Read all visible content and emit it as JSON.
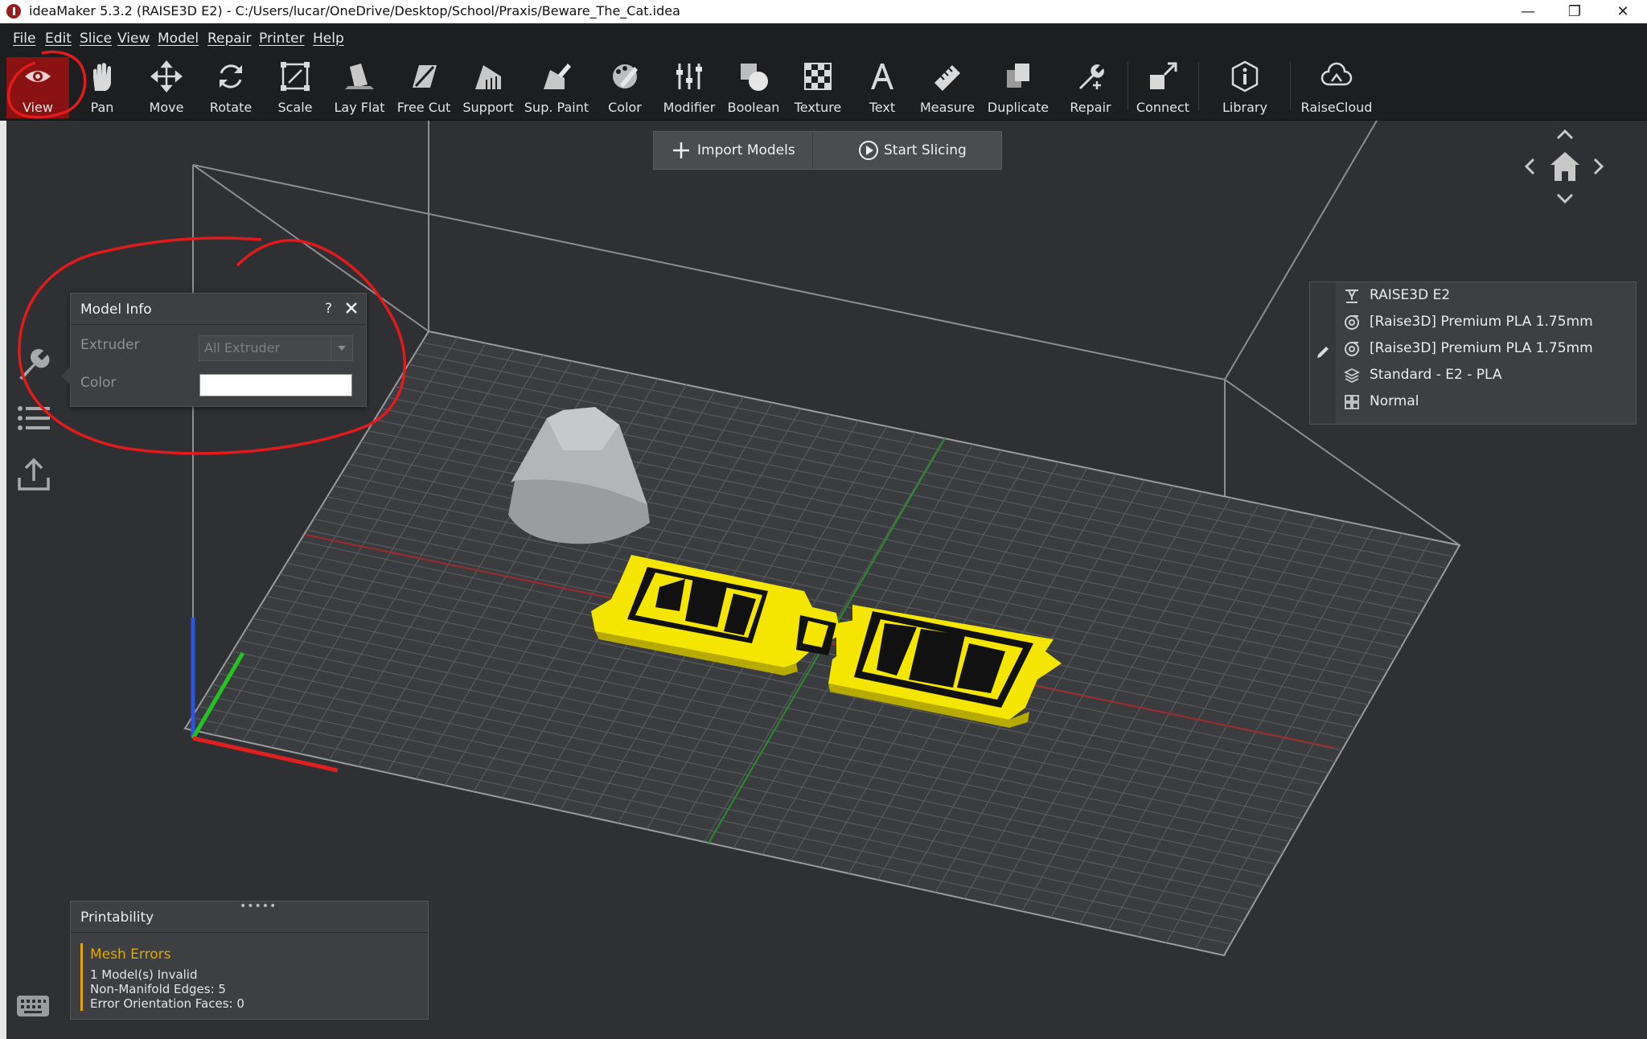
{
  "window": {
    "title": "ideaMaker 5.3.2 (RAISE3D E2) - C:/Users/lucar/OneDrive/Desktop/School/Praxis/Beware_The_Cat.idea",
    "controls": {
      "minimize": "—",
      "restore": "❐",
      "close": "✕"
    }
  },
  "menu": [
    "File",
    "Edit",
    "Slice",
    "View",
    "Model",
    "Repair",
    "Printer",
    "Help"
  ],
  "toolbar": {
    "tools": [
      {
        "label": "View",
        "icon": "eye-icon",
        "active": true
      },
      {
        "label": "Pan",
        "icon": "hand-icon"
      },
      {
        "label": "Move",
        "icon": "move-icon"
      },
      {
        "label": "Rotate",
        "icon": "rotate-icon"
      },
      {
        "label": "Scale",
        "icon": "scale-icon"
      },
      {
        "label": "Lay Flat",
        "icon": "lay-flat-icon"
      },
      {
        "label": "Free Cut",
        "icon": "free-cut-icon"
      },
      {
        "label": "Support",
        "icon": "support-icon"
      },
      {
        "label": "Sup. Paint",
        "icon": "support-paint-icon"
      },
      {
        "label": "Color",
        "icon": "color-icon"
      },
      {
        "label": "Modifier",
        "icon": "modifier-icon"
      },
      {
        "label": "Boolean",
        "icon": "boolean-icon"
      },
      {
        "label": "Texture",
        "icon": "texture-icon"
      },
      {
        "label": "Text",
        "icon": "text-icon"
      },
      {
        "label": "Measure",
        "icon": "measure-icon"
      },
      {
        "label": "Duplicate",
        "icon": "duplicate-icon"
      },
      {
        "label": "Repair",
        "icon": "repair-icon"
      },
      {
        "label": "Connect",
        "icon": "connect-icon"
      },
      {
        "label": "Library",
        "icon": "library-icon"
      },
      {
        "label": "RaiseCloud",
        "icon": "cloud-icon"
      }
    ],
    "accent": "#8a1212"
  },
  "actions": {
    "import_label": "Import Models",
    "slice_label": "Start Slicing"
  },
  "model_info": {
    "title": "Model Info",
    "help": "?",
    "extruder_label": "Extruder",
    "extruder_value": "All Extruder",
    "color_label": "Color",
    "color_value": "#ffffff"
  },
  "printer_info": {
    "rows": [
      {
        "text": "RAISE3D E2",
        "icon": "printer-icon"
      },
      {
        "text": "[Raise3D] Premium PLA 1.75mm",
        "icon": "filament-icon"
      },
      {
        "text": "[Raise3D] Premium PLA 1.75mm",
        "icon": "filament-icon"
      },
      {
        "text": "Standard - E2 - PLA",
        "icon": "layers-icon"
      },
      {
        "text": "Normal",
        "icon": "grid-icon"
      }
    ]
  },
  "printability": {
    "title": "Printability",
    "grip": "•••••",
    "error_title": "Mesh Errors",
    "lines": [
      "1 Model(s) Invalid",
      "Non-Manifold Edges: 5",
      "Error Orientation Faces: 0"
    ],
    "error_color": "#e0a800"
  },
  "model": {
    "plate_color": "#f5e600"
  }
}
